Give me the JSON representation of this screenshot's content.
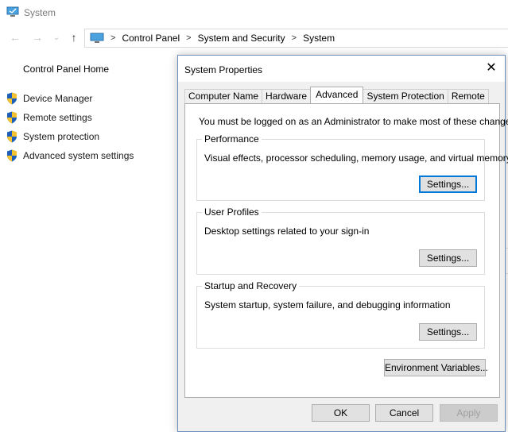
{
  "window": {
    "title": "System"
  },
  "address_bar": {
    "icon": "computer-icon",
    "crumbs": [
      "Control Panel",
      "System and Security",
      "System"
    ],
    "separator": ">"
  },
  "nav_buttons": {
    "back": "←",
    "forward": "→",
    "recent": "⌄",
    "up": "↑"
  },
  "sidebar": {
    "home": "Control Panel Home",
    "items": [
      {
        "label": "Device Manager",
        "icon": "uac-shield-icon"
      },
      {
        "label": "Remote settings",
        "icon": "uac-shield-icon"
      },
      {
        "label": "System protection",
        "icon": "uac-shield-icon"
      },
      {
        "label": "Advanced system settings",
        "icon": "uac-shield-icon"
      }
    ]
  },
  "dialog": {
    "title": "System Properties",
    "close": "✕",
    "tabs": [
      "Computer Name",
      "Hardware",
      "Advanced",
      "System Protection",
      "Remote"
    ],
    "active_tab": "Advanced",
    "admin_note": "You must be logged on as an Administrator to make most of these changes.",
    "groups": [
      {
        "legend": "Performance",
        "description": "Visual effects, processor scheduling, memory usage, and virtual memory",
        "button": "Settings..."
      },
      {
        "legend": "User Profiles",
        "description": "Desktop settings related to your sign-in",
        "button": "Settings..."
      },
      {
        "legend": "Startup and Recovery",
        "description": "System startup, system failure, and debugging information",
        "button": "Settings..."
      }
    ],
    "env_button": "Environment Variables...",
    "ok": "OK",
    "cancel": "Cancel",
    "apply": "Apply"
  },
  "colors": {
    "dialog_border": "#6b8fb8",
    "focus_blue": "#0078d7",
    "dialog_bg": "#f0f0f0"
  }
}
